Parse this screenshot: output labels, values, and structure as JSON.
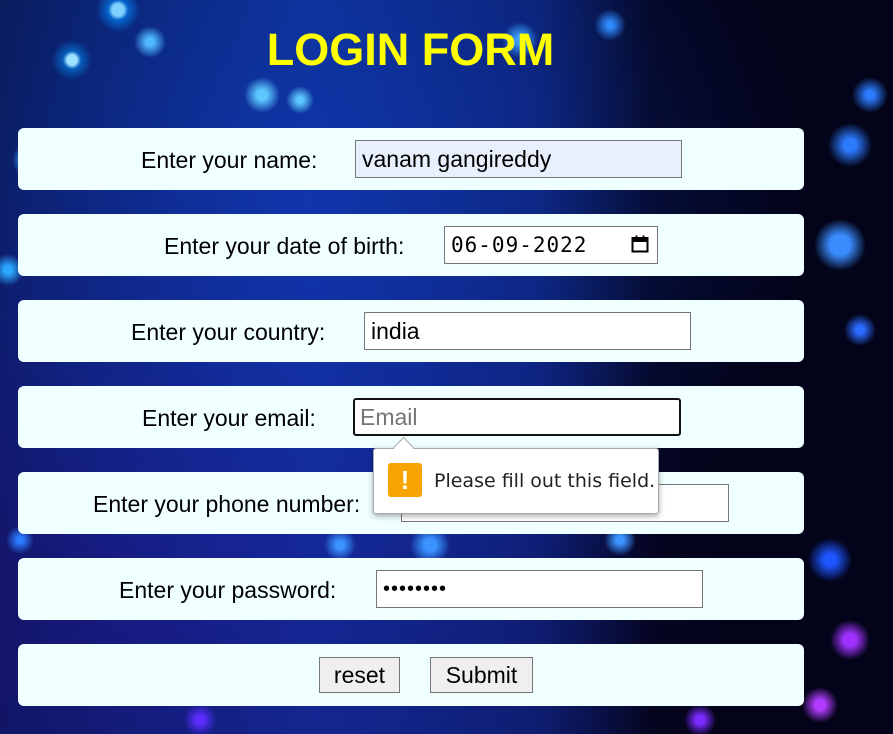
{
  "title": "LOGIN FORM",
  "form": {
    "name": {
      "label": "Enter your name:",
      "value": "vanam gangireddy"
    },
    "dob": {
      "label": "Enter your date of birth:",
      "value": "06-09-2022"
    },
    "country": {
      "label": "Enter your country:",
      "value": "india"
    },
    "email": {
      "label": "Enter your email:",
      "value": "",
      "placeholder": "Email"
    },
    "phone": {
      "label": "Enter your phone number:",
      "value": ""
    },
    "password": {
      "label": "Enter your password:",
      "value": "••••••••"
    }
  },
  "buttons": {
    "reset": "reset",
    "submit": "Submit"
  },
  "validation": {
    "message": "Please fill out this field.",
    "icon": "warning-icon",
    "icon_color": "#f7a400"
  },
  "colors": {
    "title": "#ffff00",
    "row_background": "#f0ffff",
    "autofill_background": "#e8f0fe"
  }
}
